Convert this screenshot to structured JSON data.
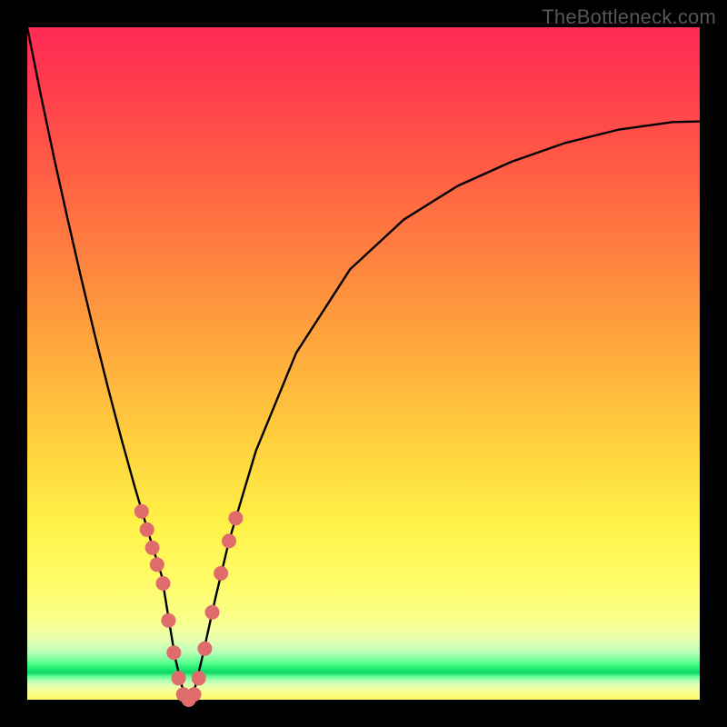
{
  "watermark": "TheBottleneck.com",
  "colors": {
    "border": "#000000",
    "curve": "#000000",
    "markers": "#e06b6b",
    "grad_top": "#ff2a55",
    "grad_mid": "#ffd13e",
    "grad_green": "#18e86f"
  },
  "chart_data": {
    "type": "line",
    "title": "",
    "xlabel": "",
    "ylabel": "",
    "xlim": [
      0,
      100
    ],
    "ylim": [
      0,
      100
    ],
    "x": [
      0,
      2,
      4,
      6,
      8,
      10,
      12,
      14,
      16,
      18,
      19,
      20,
      21,
      22,
      23,
      24,
      25,
      26,
      28,
      30,
      34,
      40,
      48,
      56,
      64,
      72,
      80,
      88,
      96,
      100
    ],
    "values": [
      100,
      90,
      80.5,
      71.5,
      62.8,
      54.4,
      46.4,
      38.8,
      31.6,
      24.9,
      21.6,
      18.4,
      12.2,
      6.2,
      2.0,
      0.0,
      2.0,
      6.2,
      15.2,
      23.6,
      37.0,
      51.6,
      64.0,
      71.4,
      76.4,
      80.0,
      82.8,
      84.8,
      85.9,
      86.0
    ],
    "annotations": {
      "minimum_x": 24,
      "minimum_value": 0
    },
    "markers": {
      "description": "highlighted sample points near valley",
      "points": [
        {
          "x": 17.0,
          "y": 28.0
        },
        {
          "x": 17.8,
          "y": 25.3
        },
        {
          "x": 18.6,
          "y": 22.6
        },
        {
          "x": 19.3,
          "y": 20.1
        },
        {
          "x": 20.2,
          "y": 17.3
        },
        {
          "x": 21.0,
          "y": 11.8
        },
        {
          "x": 21.8,
          "y": 7.0
        },
        {
          "x": 22.5,
          "y": 3.2
        },
        {
          "x": 23.2,
          "y": 0.8
        },
        {
          "x": 24.0,
          "y": 0.0
        },
        {
          "x": 24.8,
          "y": 0.8
        },
        {
          "x": 25.5,
          "y": 3.2
        },
        {
          "x": 26.4,
          "y": 7.6
        },
        {
          "x": 27.5,
          "y": 13.0
        },
        {
          "x": 28.8,
          "y": 18.8
        },
        {
          "x": 30.0,
          "y": 23.6
        },
        {
          "x": 31.0,
          "y": 27.0
        }
      ]
    }
  }
}
